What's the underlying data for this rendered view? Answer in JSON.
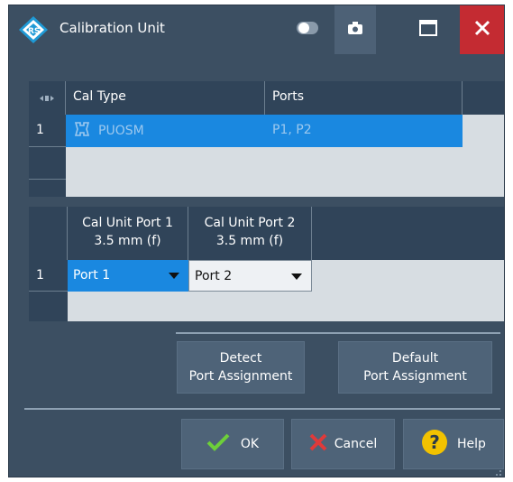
{
  "window": {
    "title": "Calibration Unit"
  },
  "titlebar": {
    "icons": [
      "rs-logo-icon",
      "toggle-icon",
      "camera-icon",
      "maximize-icon",
      "close-icon"
    ]
  },
  "cal_table": {
    "headers": [
      "Cal Type",
      "Ports"
    ],
    "rows": [
      {
        "num": "1",
        "cal_type": "PUOSM",
        "ports": "P1, P2"
      }
    ]
  },
  "port_table": {
    "headers": [
      {
        "line1": "Cal Unit Port 1",
        "line2": "3.5 mm (f)"
      },
      {
        "line1": "Cal Unit Port 2",
        "line2": "3.5 mm (f)"
      }
    ],
    "rows": [
      {
        "num": "1",
        "port1": "Port 1",
        "port2": "Port 2"
      }
    ]
  },
  "buttons": {
    "detect_line1": "Detect",
    "detect_line2": "Port Assignment",
    "default_line1": "Default",
    "default_line2": "Port Assignment",
    "ok": "OK",
    "cancel": "Cancel",
    "help": "Help"
  },
  "colors": {
    "background": "#3c4f62",
    "header": "#304459",
    "selection": "#1a88e0",
    "close": "#c42b32",
    "ok_check": "#6dcf3a",
    "cancel_x": "#e03a3a",
    "help": "#f2c200"
  }
}
